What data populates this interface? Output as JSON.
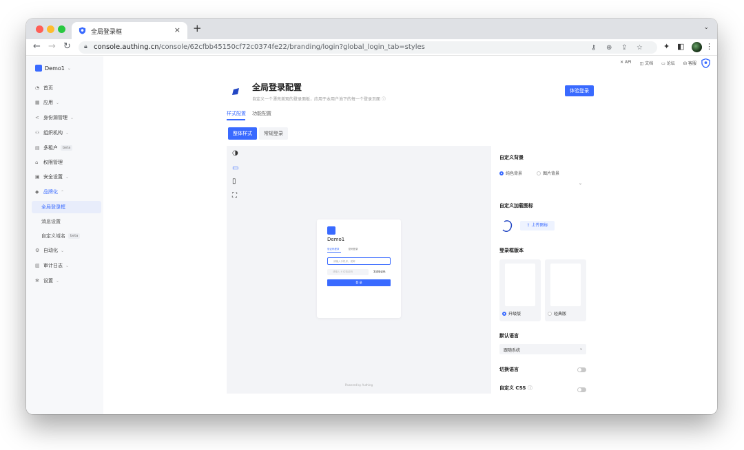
{
  "browser": {
    "tab_title": "全局登录框",
    "url_host": "console.authing.cn",
    "url_path": "/console/62cfbb45150cf72c0374fe22/branding/login?global_login_tab=styles"
  },
  "colors": {
    "accent": "#396aff",
    "sidebar_bg": "#f7f8fa",
    "active_bg": "#e8edfb"
  },
  "sidebar": {
    "app_name": "Demo1",
    "items": [
      {
        "label": "首页",
        "icon": "home-icon"
      },
      {
        "label": "应用",
        "icon": "apps-icon"
      },
      {
        "label": "身份源管理",
        "icon": "share-icon"
      },
      {
        "label": "组织机构",
        "icon": "org-icon"
      },
      {
        "label": "多租户",
        "icon": "tenant-icon",
        "badge": "beta"
      },
      {
        "label": "权限管理",
        "icon": "lock-icon"
      },
      {
        "label": "安全设置",
        "icon": "shield-icon"
      },
      {
        "label": "品牌化",
        "icon": "brand-icon"
      },
      {
        "label": "自动化",
        "icon": "automation-icon"
      },
      {
        "label": "审计日志",
        "icon": "log-icon"
      },
      {
        "label": "设置",
        "icon": "gear-icon"
      }
    ],
    "subitems": [
      {
        "label": "全局登录框"
      },
      {
        "label": "消息设置"
      },
      {
        "label": "自定义域名",
        "badge": "beta"
      }
    ]
  },
  "topbar": {
    "api": "API",
    "docs": "文档",
    "forum": "论坛",
    "support": "客服"
  },
  "header": {
    "title": "全局登录配置",
    "description": "自定义一个漂亮美观的登录面板，应用于本用户池下的每一个登录页面",
    "preview_button": "体验登录"
  },
  "tabs": [
    {
      "label": "样式配置"
    },
    {
      "label": "功能配置"
    }
  ],
  "segments": [
    {
      "label": "整体样式"
    },
    {
      "label": "常规登录"
    }
  ],
  "preview": {
    "app_name": "Demo1",
    "tabs": [
      "验证码登录",
      "密码登录"
    ],
    "input_placeholder": "请输入手机号，或邮",
    "code_placeholder": "请输入 6 位验证码",
    "send_code": "发送验证码",
    "login_button": "登 录",
    "powered_by": "Powered by Authing"
  },
  "settings": {
    "background": {
      "title": "自定义背景",
      "options": [
        "纯色背景",
        "图片背景"
      ],
      "selected": "纯色背景"
    },
    "loading_icon": {
      "title": "自定义加载图标",
      "upload": "上传图标"
    },
    "login_box_version": {
      "title": "登录框版本",
      "options": [
        "升级版",
        "经典版"
      ],
      "selected": "升级版"
    },
    "default_language": {
      "title": "默认语言",
      "value": "跟随系统"
    },
    "switch_language": {
      "title": "切换语言",
      "enabled": false
    },
    "custom_css": {
      "title": "自定义 CSS",
      "enabled": false
    }
  }
}
